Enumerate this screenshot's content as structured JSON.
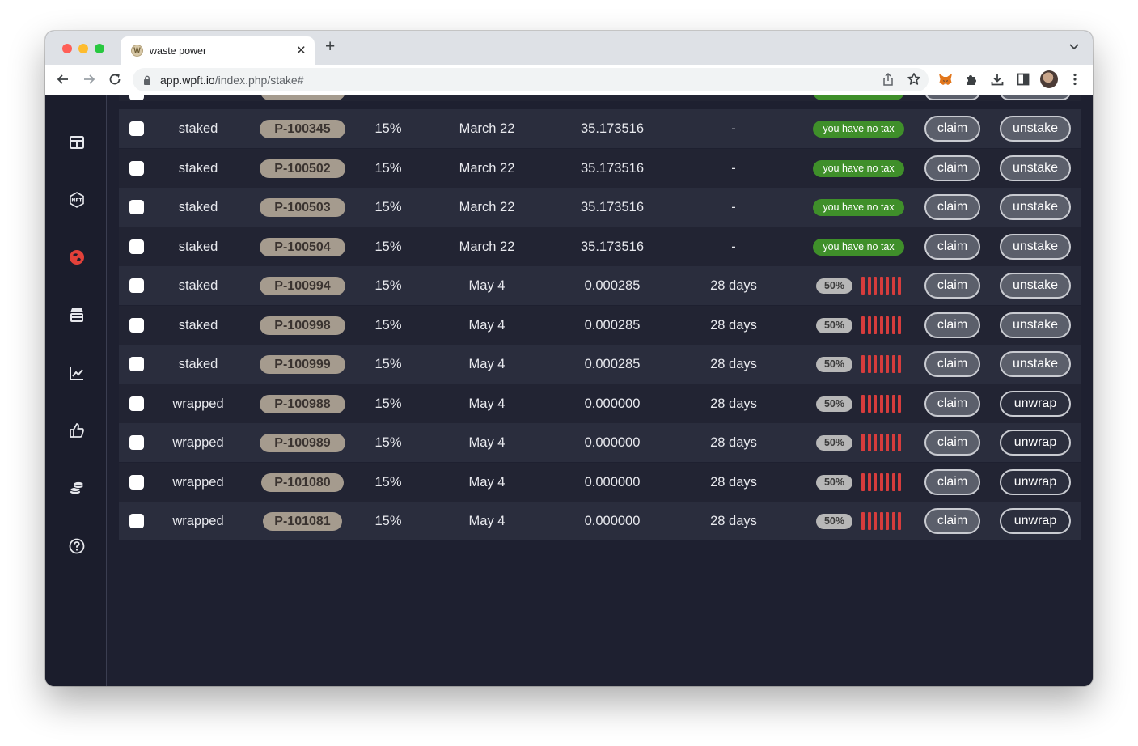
{
  "browser": {
    "tab_title": "waste power",
    "tab_favicon_letter": "W",
    "new_tab_symbol": "+",
    "close_symbol": "✕",
    "url_host": "app.wpft.io",
    "url_path": "/index.php/stake#"
  },
  "sidebar": {
    "items": [
      {
        "icon": "dashboard-icon",
        "active": false
      },
      {
        "icon": "nft-icon",
        "active": false
      },
      {
        "icon": "staking-icon",
        "active": true
      },
      {
        "icon": "store-icon",
        "active": false
      },
      {
        "icon": "chart-icon",
        "active": false
      },
      {
        "icon": "thumbs-up-icon",
        "active": false
      },
      {
        "icon": "coins-icon",
        "active": false
      },
      {
        "icon": "help-icon",
        "active": false
      }
    ],
    "active_color": "#e2413a"
  },
  "colors": {
    "tax_badge": "#3f8f2a",
    "timer_bar": "#d63c3c",
    "id_pill": "#a59b8e"
  },
  "rows": [
    {
      "status": "staked",
      "id": "P-100345",
      "rate": "15%",
      "date": "March 22",
      "amount": "35.173516",
      "lock": "-",
      "tax": "you have no tax",
      "claim": "claim",
      "action": "unstake"
    },
    {
      "status": "staked",
      "id": "P-100502",
      "rate": "15%",
      "date": "March 22",
      "amount": "35.173516",
      "lock": "-",
      "tax": "you have no tax",
      "claim": "claim",
      "action": "unstake"
    },
    {
      "status": "staked",
      "id": "P-100503",
      "rate": "15%",
      "date": "March 22",
      "amount": "35.173516",
      "lock": "-",
      "tax": "you have no tax",
      "claim": "claim",
      "action": "unstake"
    },
    {
      "status": "staked",
      "id": "P-100504",
      "rate": "15%",
      "date": "March 22",
      "amount": "35.173516",
      "lock": "-",
      "tax": "you have no tax",
      "claim": "claim",
      "action": "unstake"
    },
    {
      "status": "staked",
      "id": "P-100994",
      "rate": "15%",
      "date": "May 4",
      "amount": "0.000285",
      "lock": "28 days",
      "tax": "50%",
      "claim": "claim",
      "action": "unstake"
    },
    {
      "status": "staked",
      "id": "P-100998",
      "rate": "15%",
      "date": "May 4",
      "amount": "0.000285",
      "lock": "28 days",
      "tax": "50%",
      "claim": "claim",
      "action": "unstake"
    },
    {
      "status": "staked",
      "id": "P-100999",
      "rate": "15%",
      "date": "May 4",
      "amount": "0.000285",
      "lock": "28 days",
      "tax": "50%",
      "claim": "claim",
      "action": "unstake"
    },
    {
      "status": "wrapped",
      "id": "P-100988",
      "rate": "15%",
      "date": "May 4",
      "amount": "0.000000",
      "lock": "28 days",
      "tax": "50%",
      "claim": "claim",
      "action": "unwrap"
    },
    {
      "status": "wrapped",
      "id": "P-100989",
      "rate": "15%",
      "date": "May 4",
      "amount": "0.000000",
      "lock": "28 days",
      "tax": "50%",
      "claim": "claim",
      "action": "unwrap"
    },
    {
      "status": "wrapped",
      "id": "P-101080",
      "rate": "15%",
      "date": "May 4",
      "amount": "0.000000",
      "lock": "28 days",
      "tax": "50%",
      "claim": "claim",
      "action": "unwrap"
    },
    {
      "status": "wrapped",
      "id": "P-101081",
      "rate": "15%",
      "date": "May 4",
      "amount": "0.000000",
      "lock": "28 days",
      "tax": "50%",
      "claim": "claim",
      "action": "unwrap"
    }
  ]
}
